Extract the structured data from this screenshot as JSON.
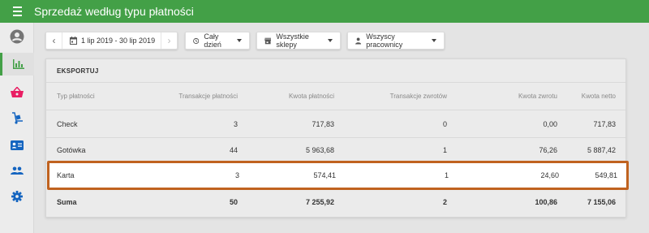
{
  "appbar": {
    "title": "Sprzedaż według typu płatności"
  },
  "sidebar": {
    "items": [
      {
        "icon": "account-circle-icon"
      },
      {
        "icon": "bar-chart-icon",
        "active": true
      },
      {
        "icon": "basket-icon"
      },
      {
        "icon": "hand-truck-icon"
      },
      {
        "icon": "id-card-icon"
      },
      {
        "icon": "people-icon"
      },
      {
        "icon": "gear-icon"
      }
    ]
  },
  "filters": {
    "date_range": "1 lip 2019 - 30 lip 2019",
    "time": "Cały dzień",
    "stores": "Wszystkie sklepy",
    "employees": "Wszyscy pracownicy"
  },
  "report": {
    "export_label": "EKSPORTUJ",
    "columns": [
      "Typ płatności",
      "Transakcje płatności",
      "Kwota płatności",
      "Transakcje zwrotów",
      "Kwota zwrotu",
      "Kwota netto"
    ],
    "rows": [
      [
        "Check",
        "3",
        "717,83",
        "0",
        "0,00",
        "717,83"
      ],
      [
        "Gotówka",
        "44",
        "5 963,68",
        "1",
        "76,26",
        "5 887,42"
      ],
      [
        "Karta",
        "3",
        "574,41",
        "1",
        "24,60",
        "549,81"
      ]
    ],
    "total": [
      "Suma",
      "50",
      "7 255,92",
      "2",
      "100,86",
      "7 155,06"
    ]
  },
  "colors": {
    "appbar": "#43a047",
    "highlight_border": "#c0621f",
    "basket_icon": "#e91e63",
    "nav_icon": "#1565c0"
  }
}
